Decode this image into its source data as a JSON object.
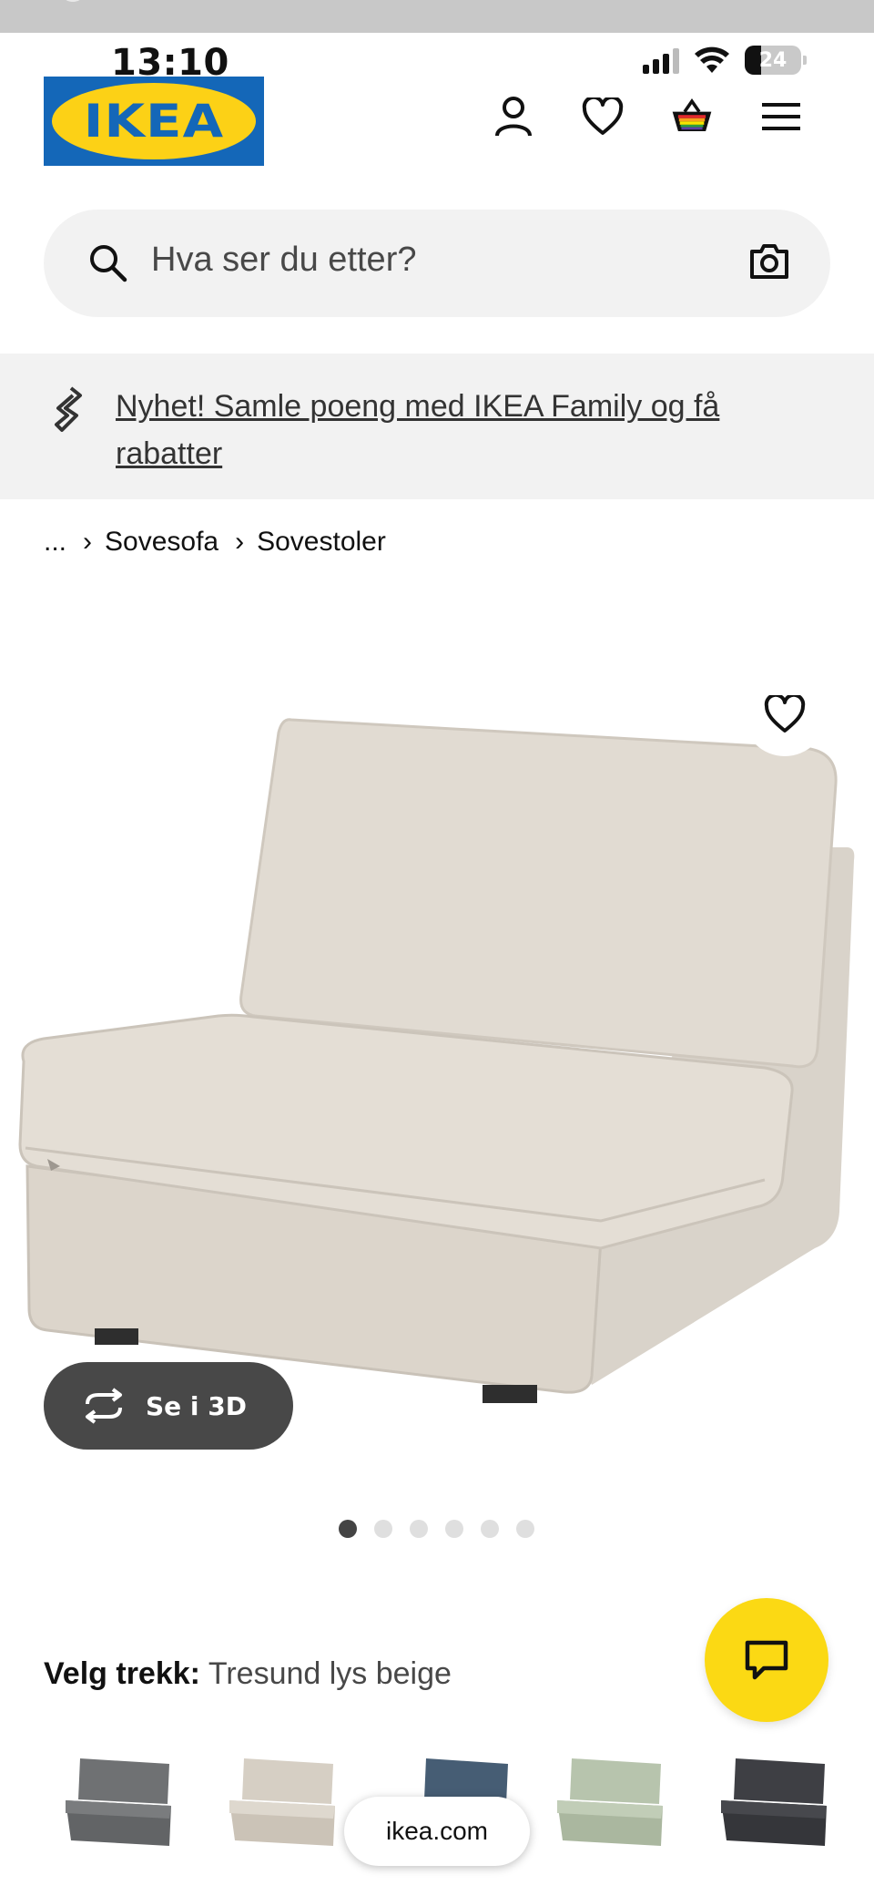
{
  "status_bar": {
    "time": "13:10",
    "battery": "24",
    "icons": [
      "cellular-signal-icon",
      "wifi-icon",
      "battery-icon"
    ]
  },
  "header": {
    "logo_text": "IKEA",
    "icons": [
      "user-icon",
      "heart-icon",
      "shopping-bag-icon",
      "menu-icon"
    ]
  },
  "search": {
    "placeholder": "Hva ser du etter?",
    "icons": [
      "search-icon",
      "camera-icon"
    ]
  },
  "promo": {
    "text": "Nyhet! Samle poeng med IKEA Family og få rabatter",
    "icon": "ikea-family-icon"
  },
  "breadcrumb": {
    "items": [
      "...",
      "Sovesofa",
      "Sovestoler"
    ]
  },
  "product": {
    "view_3d_label": "Se i 3D",
    "image_count": 6,
    "active_image": 1
  },
  "cover": {
    "label": "Velg trekk:",
    "value": "Tresund lys beige",
    "swatch_colors": [
      "#6f7173",
      "#d6cfc4",
      "#465d74",
      "#b7c4ad",
      "#3e3f44"
    ]
  },
  "browser": {
    "url": "ikea.com"
  },
  "colors": {
    "ikea_blue": "#1467b8",
    "ikea_yellow": "#fcd116",
    "chat_yellow": "#fbd914"
  }
}
